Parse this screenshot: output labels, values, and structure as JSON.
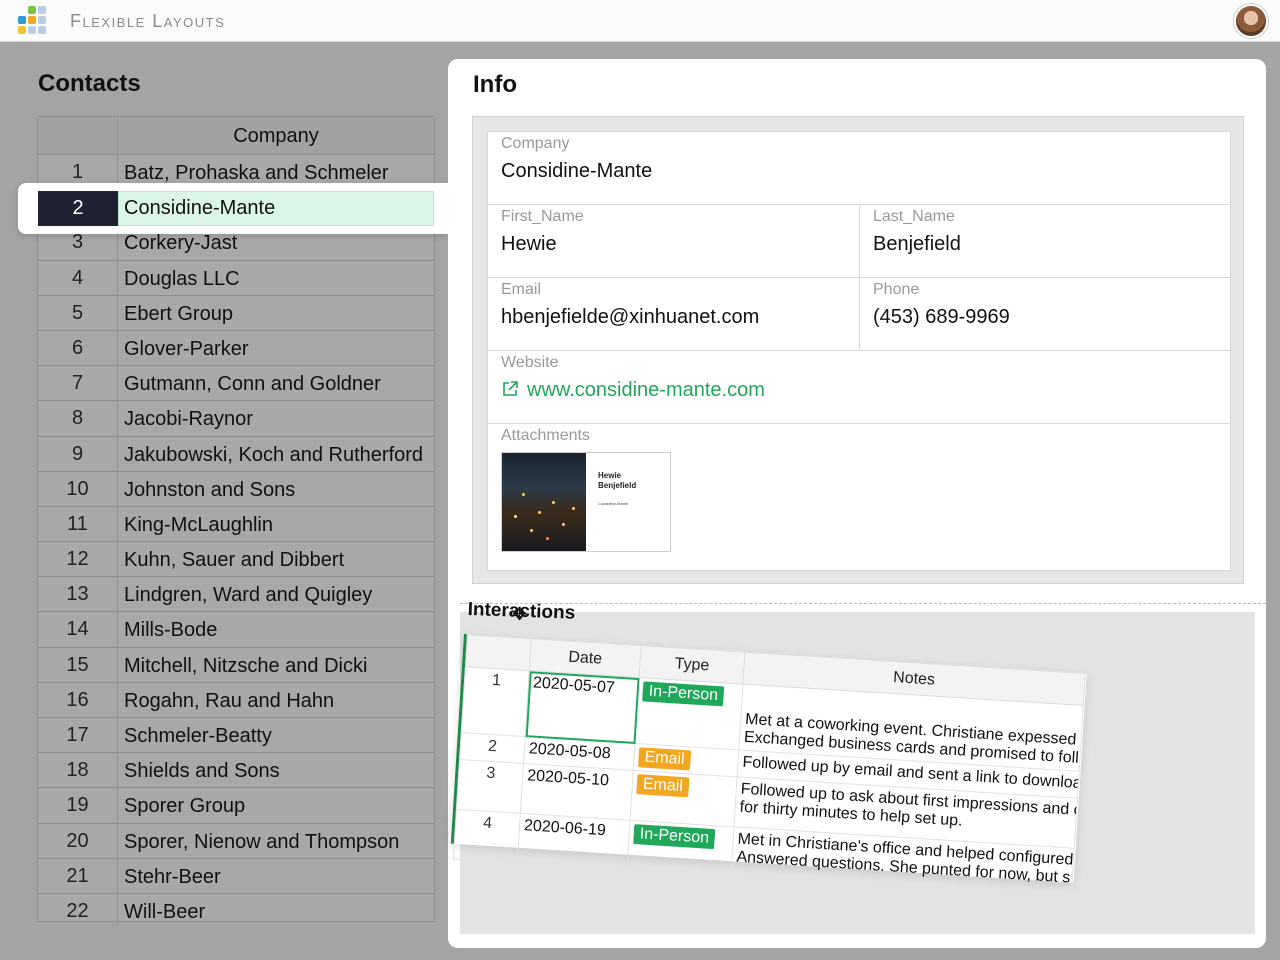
{
  "app": {
    "title": "Flexible Layouts"
  },
  "colors": {
    "accent": "#1fa85a",
    "email_badge": "#f1a71f",
    "selected_row_bg": "#dcf5e9",
    "selected_num_bg": "#1e2233"
  },
  "contacts": {
    "title": "Contacts",
    "column_header": "Company",
    "selected_index": 2,
    "rows": [
      {
        "num": "1",
        "company": "Batz, Prohaska and Schmeler"
      },
      {
        "num": "2",
        "company": "Considine-Mante"
      },
      {
        "num": "3",
        "company": "Corkery-Jast"
      },
      {
        "num": "4",
        "company": "Douglas LLC"
      },
      {
        "num": "5",
        "company": "Ebert Group"
      },
      {
        "num": "6",
        "company": "Glover-Parker"
      },
      {
        "num": "7",
        "company": "Gutmann, Conn and Goldner"
      },
      {
        "num": "8",
        "company": "Jacobi-Raynor"
      },
      {
        "num": "9",
        "company": "Jakubowski, Koch and Rutherford"
      },
      {
        "num": "10",
        "company": "Johnston and Sons"
      },
      {
        "num": "11",
        "company": "King-McLaughlin"
      },
      {
        "num": "12",
        "company": "Kuhn, Sauer and Dibbert"
      },
      {
        "num": "13",
        "company": "Lindgren, Ward and Quigley"
      },
      {
        "num": "14",
        "company": "Mills-Bode"
      },
      {
        "num": "15",
        "company": "Mitchell, Nitzsche and Dicki"
      },
      {
        "num": "16",
        "company": "Rogahn, Rau and Hahn"
      },
      {
        "num": "17",
        "company": "Schmeler-Beatty"
      },
      {
        "num": "18",
        "company": "Shields and Sons"
      },
      {
        "num": "19",
        "company": "Sporer Group"
      },
      {
        "num": "20",
        "company": "Sporer, Nienow and Thompson"
      },
      {
        "num": "21",
        "company": "Stehr-Beer"
      },
      {
        "num": "22",
        "company": "Will-Beer"
      }
    ]
  },
  "info": {
    "title": "Info",
    "company": {
      "label": "Company",
      "value": "Considine-Mante"
    },
    "first_name": {
      "label": "First_Name",
      "value": "Hewie"
    },
    "last_name": {
      "label": "Last_Name",
      "value": "Benjefield"
    },
    "email": {
      "label": "Email",
      "value": "hbenjefielde@xinhuanet.com"
    },
    "phone": {
      "label": "Phone",
      "value": "(453) 689-9969"
    },
    "website": {
      "label": "Website",
      "value": "www.considine-mante.com",
      "icon": "external-link-icon"
    },
    "attachments": {
      "label": "Attachments",
      "card": {
        "name_line1": "Hewie",
        "name_line2": "Benjefield",
        "company": "Considine-Mante"
      }
    }
  },
  "interactions": {
    "title": "Interactions",
    "columns": [
      "Date",
      "Type",
      "Notes"
    ],
    "rows": [
      {
        "num": "1",
        "date": "2020-05-07",
        "type": "In-Person",
        "notes": [
          "Met at a coworking event. Christiane expessed",
          "Exchanged business cards and promised to foll"
        ]
      },
      {
        "num": "2",
        "date": "2020-05-08",
        "type": "Email",
        "notes": [
          "Followed up by email and sent a link to downloa"
        ]
      },
      {
        "num": "3",
        "date": "2020-05-10",
        "type": "Email",
        "notes": [
          "Followed up to ask about first impressions and c",
          "for thirty minutes to help set up."
        ]
      },
      {
        "num": "4",
        "date": "2020-06-19",
        "type": "In-Person",
        "notes": [
          "Met in Christiane's office and helped configured",
          "Answered questions. She punted for now, but s"
        ]
      }
    ]
  }
}
